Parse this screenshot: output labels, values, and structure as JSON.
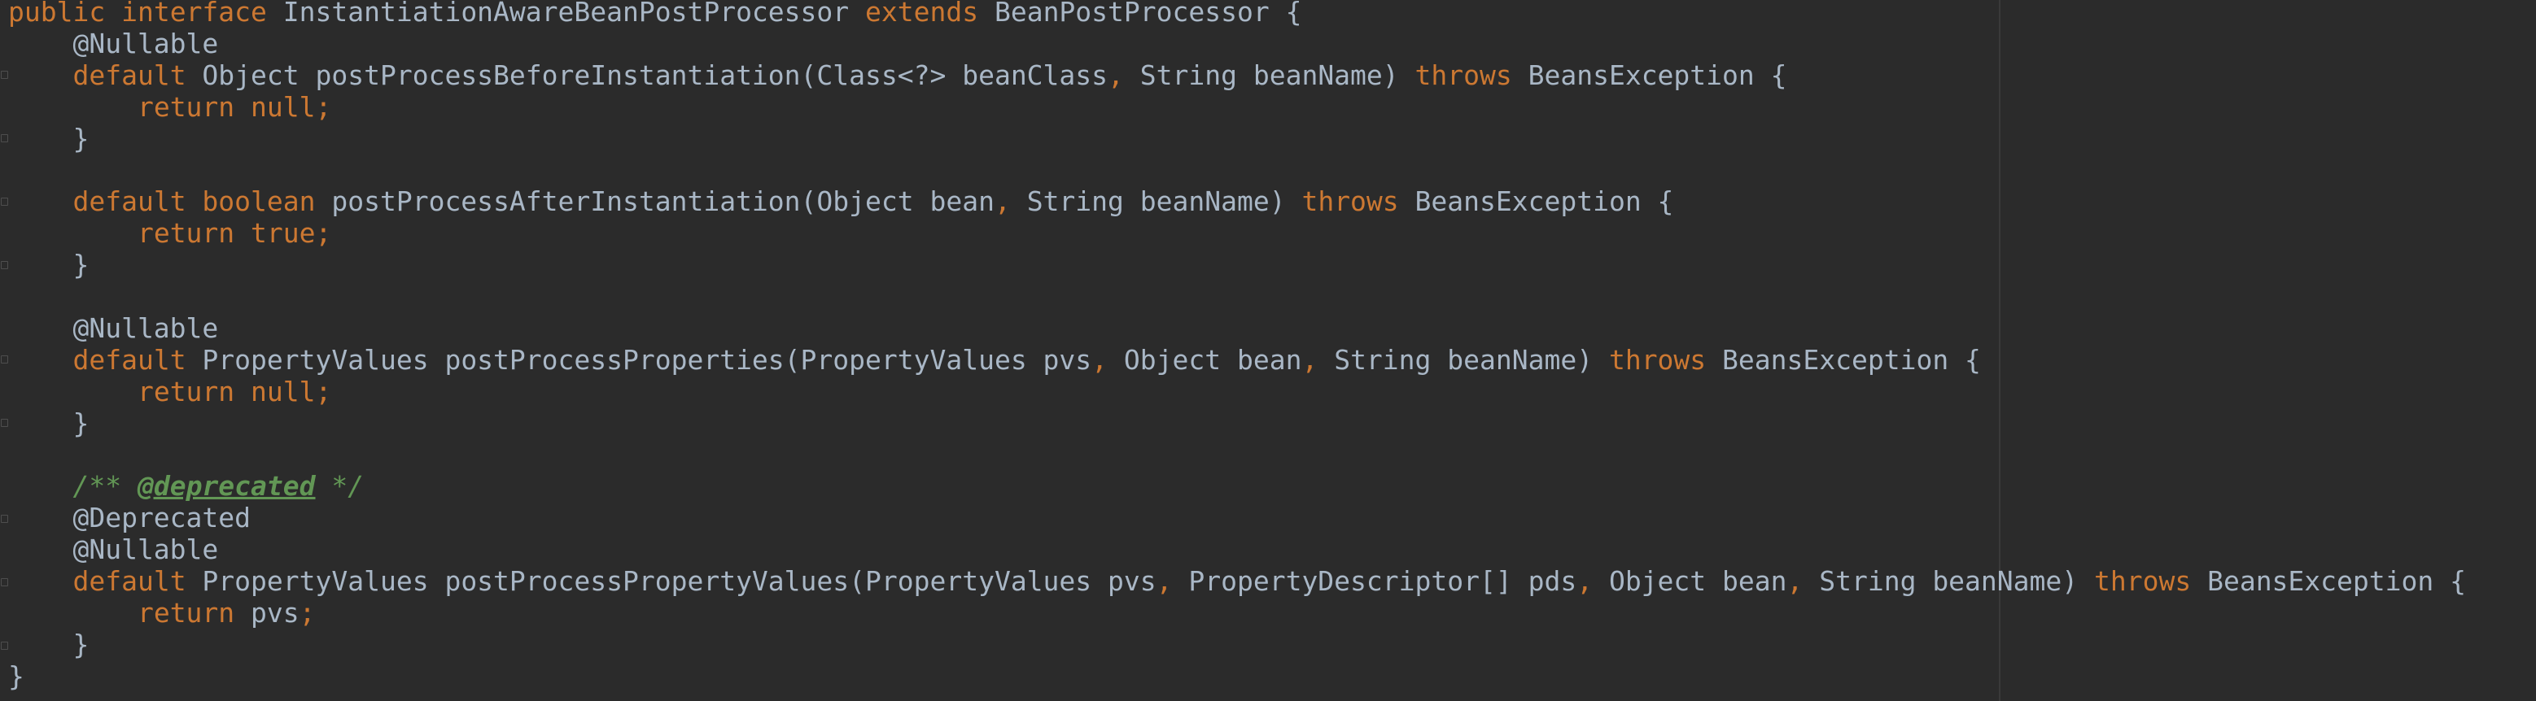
{
  "editor": {
    "language": "java",
    "theme_background": "#2b2b2b",
    "colors": {
      "keyword": "#cc7832",
      "text": "#a9b7c6",
      "comment": "#629755"
    }
  },
  "code": {
    "l1": {
      "t1": "public",
      "t2": " ",
      "t3": "interface",
      "t4": " InstantiationAwareBeanPostProcessor ",
      "t5": "extends",
      "t6": " BeanPostProcessor {"
    },
    "l2": {
      "t1": "    @Nullable"
    },
    "l3": {
      "t1": "    ",
      "t2": "default",
      "t3": " Object postProcessBeforeInstantiation(Class<?> beanClass",
      "t4": ",",
      "t5": " String beanName) ",
      "t6": "throws",
      "t7": " BeansException {"
    },
    "l4": {
      "t1": "        ",
      "t2": "return null;"
    },
    "l5": {
      "t1": "    }"
    },
    "l6": {
      "t1": ""
    },
    "l7": {
      "t1": "    ",
      "t2": "default boolean",
      "t3": " postProcessAfterInstantiation(Object bean",
      "t4": ",",
      "t5": " String beanName) ",
      "t6": "throws",
      "t7": " BeansException {"
    },
    "l8": {
      "t1": "        ",
      "t2": "return true;"
    },
    "l9": {
      "t1": "    }"
    },
    "l10": {
      "t1": ""
    },
    "l11": {
      "t1": "    @Nullable"
    },
    "l12": {
      "t1": "    ",
      "t2": "default",
      "t3": " PropertyValues postProcessProperties(PropertyValues pvs",
      "t4": ",",
      "t5": " Object bean",
      "t6": ",",
      "t7": " String beanName) ",
      "t8": "throws",
      "t9": " BeansException {"
    },
    "l13": {
      "t1": "        ",
      "t2": "return null;"
    },
    "l14": {
      "t1": "    }"
    },
    "l15": {
      "t1": ""
    },
    "l16": {
      "t1": "    ",
      "t2": "/** ",
      "t3": "@deprecated",
      "t4": " */"
    },
    "l17": {
      "t1": "    @Deprecated"
    },
    "l18": {
      "t1": "    @Nullable"
    },
    "l19": {
      "t1": "    ",
      "t2": "default",
      "t3": " PropertyValues postProcessPropertyValues(PropertyValues pvs",
      "t4": ",",
      "t5": " PropertyDescriptor[] pds",
      "t6": ",",
      "t7": " Object bean",
      "t8": ",",
      "t9": " String beanName) ",
      "t10": "throws",
      "t11": " BeansException {"
    },
    "l20": {
      "t1": "        ",
      "t2": "return",
      "t3": " pvs",
      "t4": ";"
    },
    "l21": {
      "t1": "    }"
    },
    "l22": {
      "t1": "}"
    }
  }
}
